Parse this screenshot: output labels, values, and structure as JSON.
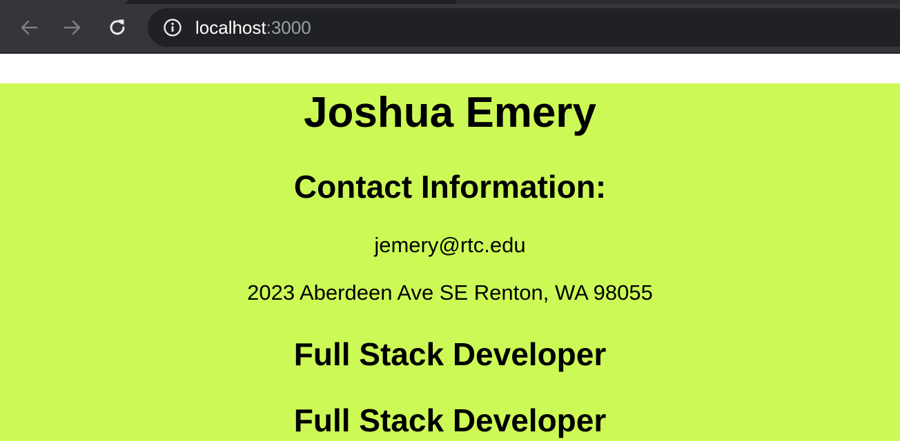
{
  "browser": {
    "url_host": "localhost",
    "url_port": ":3000",
    "icons": {
      "back": "arrow-left-icon",
      "forward": "arrow-right-icon",
      "reload": "reload-icon",
      "site_info": "info-icon"
    }
  },
  "resume": {
    "name": "Joshua Emery",
    "contact_heading": "Contact Information:",
    "email": "jemery@rtc.edu",
    "address": "2023 Aberdeen Ave SE Renton, WA 98055",
    "titles": [
      "Full Stack Developer",
      "Full Stack Developer"
    ]
  },
  "colors": {
    "page_background": "#ccf955",
    "browser_toolbar": "#35363a",
    "omnibox": "#202124"
  }
}
